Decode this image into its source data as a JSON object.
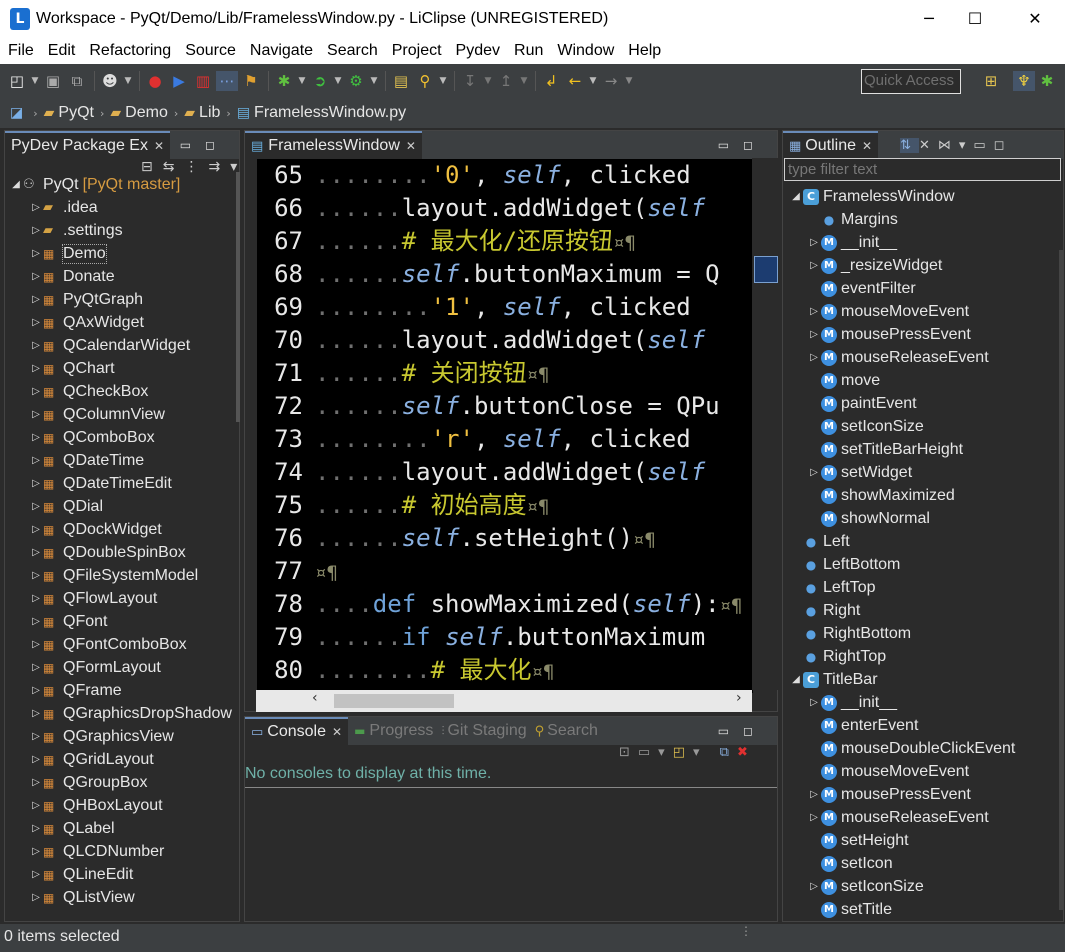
{
  "window": {
    "title": "Workspace - PyQt/Demo/Lib/FramelessWindow.py - LiClipse (UNREGISTERED)",
    "logo": "L",
    "minimize": "─",
    "maximize": "☐",
    "close": "✕"
  },
  "menu": [
    "File",
    "Edit",
    "Refactoring",
    "Source",
    "Navigate",
    "Search",
    "Project",
    "Pydev",
    "Run",
    "Window",
    "Help"
  ],
  "toolbar": {
    "quick_access_placeholder": "Quick Access",
    "icons": [
      "new-icon",
      "save-icon",
      "save-all-icon",
      "settings-icon",
      "stop-icon",
      "run-icon",
      "debug-icon",
      "toggle-icon",
      "open-type-icon",
      "bug-icon",
      "run-green-icon",
      "external-tool-icon",
      "open-file-icon",
      "search-icon",
      "prev-annotation-icon",
      "next-annotation-icon",
      "back-icon",
      "forward-icon",
      "perspective-icon",
      "python-perspective-icon",
      "debug-perspective-icon"
    ]
  },
  "breadcrumb": [
    "PyQt",
    "Demo",
    "Lib",
    "FramelessWindow.py"
  ],
  "explorer": {
    "tab_label": "PyDev Package Ex",
    "project": "PyQt",
    "branch": "[PyQt master]",
    "items": [
      {
        "label": ".idea",
        "kind": "folder"
      },
      {
        "label": ".settings",
        "kind": "folder"
      },
      {
        "label": "Demo",
        "kind": "package"
      },
      {
        "label": "Donate",
        "kind": "package"
      },
      {
        "label": "PyQtGraph",
        "kind": "package"
      },
      {
        "label": "QAxWidget",
        "kind": "package"
      },
      {
        "label": "QCalendarWidget",
        "kind": "package"
      },
      {
        "label": "QChart",
        "kind": "package"
      },
      {
        "label": "QCheckBox",
        "kind": "package"
      },
      {
        "label": "QColumnView",
        "kind": "package"
      },
      {
        "label": "QComboBox",
        "kind": "package"
      },
      {
        "label": "QDateTime",
        "kind": "package"
      },
      {
        "label": "QDateTimeEdit",
        "kind": "package"
      },
      {
        "label": "QDial",
        "kind": "package"
      },
      {
        "label": "QDockWidget",
        "kind": "package"
      },
      {
        "label": "QDoubleSpinBox",
        "kind": "package"
      },
      {
        "label": "QFileSystemModel",
        "kind": "package"
      },
      {
        "label": "QFlowLayout",
        "kind": "package"
      },
      {
        "label": "QFont",
        "kind": "package"
      },
      {
        "label": "QFontComboBox",
        "kind": "package"
      },
      {
        "label": "QFormLayout",
        "kind": "package"
      },
      {
        "label": "QFrame",
        "kind": "package"
      },
      {
        "label": "QGraphicsDropShadow",
        "kind": "package"
      },
      {
        "label": "QGraphicsView",
        "kind": "package"
      },
      {
        "label": "QGridLayout",
        "kind": "package"
      },
      {
        "label": "QGroupBox",
        "kind": "package"
      },
      {
        "label": "QHBoxLayout",
        "kind": "package"
      },
      {
        "label": "QLabel",
        "kind": "package"
      },
      {
        "label": "QLCDNumber",
        "kind": "package"
      },
      {
        "label": "QLineEdit",
        "kind": "package"
      },
      {
        "label": "QListView",
        "kind": "package"
      }
    ]
  },
  "editor": {
    "tab_label": "FramelessWindow",
    "lines": [
      {
        "num": "65",
        "indent": "........",
        "parts": [
          {
            "t": "'0'",
            "c": "str"
          },
          {
            "t": ", ",
            "c": ""
          },
          {
            "t": "self",
            "c": "self"
          },
          {
            "t": ", clicked",
            "c": ""
          }
        ]
      },
      {
        "num": "66",
        "indent": "......",
        "parts": [
          {
            "t": "layout.addWidget(",
            "c": ""
          },
          {
            "t": "self",
            "c": "self"
          }
        ]
      },
      {
        "num": "67",
        "indent": "......",
        "parts": [
          {
            "t": "# 最大化/还原按钮",
            "c": "cm"
          },
          {
            "t": "¤¶",
            "c": "pil"
          }
        ]
      },
      {
        "num": "68",
        "indent": "......",
        "parts": [
          {
            "t": "self",
            "c": "self"
          },
          {
            "t": ".buttonMaximum = Q",
            "c": ""
          }
        ]
      },
      {
        "num": "69",
        "indent": "........",
        "parts": [
          {
            "t": "'1'",
            "c": "str"
          },
          {
            "t": ", ",
            "c": ""
          },
          {
            "t": "self",
            "c": "self"
          },
          {
            "t": ", clicked",
            "c": ""
          }
        ]
      },
      {
        "num": "70",
        "indent": "......",
        "parts": [
          {
            "t": "layout.addWidget(",
            "c": ""
          },
          {
            "t": "self",
            "c": "self"
          }
        ]
      },
      {
        "num": "71",
        "indent": "......",
        "parts": [
          {
            "t": "# 关闭按钮",
            "c": "cm"
          },
          {
            "t": "¤¶",
            "c": "pil"
          }
        ]
      },
      {
        "num": "72",
        "indent": "......",
        "parts": [
          {
            "t": "self",
            "c": "self"
          },
          {
            "t": ".buttonClose = QPu",
            "c": ""
          }
        ]
      },
      {
        "num": "73",
        "indent": "........",
        "parts": [
          {
            "t": "'r'",
            "c": "str"
          },
          {
            "t": ", ",
            "c": ""
          },
          {
            "t": "self",
            "c": "self"
          },
          {
            "t": ", clicked",
            "c": ""
          }
        ]
      },
      {
        "num": "74",
        "indent": "......",
        "parts": [
          {
            "t": "layout.addWidget(",
            "c": ""
          },
          {
            "t": "self",
            "c": "self"
          }
        ]
      },
      {
        "num": "75",
        "indent": "......",
        "parts": [
          {
            "t": "# 初始高度",
            "c": "cm"
          },
          {
            "t": "¤¶",
            "c": "pil"
          }
        ]
      },
      {
        "num": "76",
        "indent": "......",
        "parts": [
          {
            "t": "self",
            "c": "self"
          },
          {
            "t": ".setHeight()",
            "c": ""
          },
          {
            "t": "¤¶",
            "c": "pil"
          }
        ]
      },
      {
        "num": "77",
        "indent": "",
        "parts": [
          {
            "t": "¤¶",
            "c": "pil"
          }
        ]
      },
      {
        "num": "78",
        "indent": "....",
        "parts": [
          {
            "t": "def",
            "c": "kw"
          },
          {
            "t": " showMaximized(",
            "c": ""
          },
          {
            "t": "self",
            "c": "self"
          },
          {
            "t": "):",
            "c": ""
          },
          {
            "t": "¤¶",
            "c": "pil"
          }
        ]
      },
      {
        "num": "79",
        "indent": "......",
        "parts": [
          {
            "t": "if",
            "c": "kw"
          },
          {
            "t": " ",
            "c": ""
          },
          {
            "t": "self",
            "c": "self"
          },
          {
            "t": ".buttonMaximum",
            "c": ""
          }
        ]
      },
      {
        "num": "80",
        "indent": "........",
        "parts": [
          {
            "t": "# 最大化",
            "c": "cm"
          },
          {
            "t": "¤¶",
            "c": "pil"
          }
        ]
      }
    ]
  },
  "console": {
    "tabs": [
      "Console",
      "Progress",
      "Git Staging",
      "Search"
    ],
    "message": "No consoles to display at this time."
  },
  "outline": {
    "tab_label": "Outline",
    "filter_placeholder": "type filter text",
    "items": [
      {
        "label": "FramelessWindow",
        "kind": "class",
        "level": 0,
        "expand": "open"
      },
      {
        "label": "Margins",
        "kind": "attr",
        "level": 1,
        "expand": ""
      },
      {
        "label": "__init__",
        "kind": "method",
        "level": 1,
        "expand": "closed"
      },
      {
        "label": "_resizeWidget",
        "kind": "method",
        "level": 1,
        "expand": "closed"
      },
      {
        "label": "eventFilter",
        "kind": "method",
        "level": 1,
        "expand": ""
      },
      {
        "label": "mouseMoveEvent",
        "kind": "method",
        "level": 1,
        "expand": "closed"
      },
      {
        "label": "mousePressEvent",
        "kind": "method",
        "level": 1,
        "expand": "closed"
      },
      {
        "label": "mouseReleaseEvent",
        "kind": "method",
        "level": 1,
        "expand": "closed"
      },
      {
        "label": "move",
        "kind": "method",
        "level": 1,
        "expand": ""
      },
      {
        "label": "paintEvent",
        "kind": "method",
        "level": 1,
        "expand": ""
      },
      {
        "label": "setIconSize",
        "kind": "method",
        "level": 1,
        "expand": ""
      },
      {
        "label": "setTitleBarHeight",
        "kind": "method",
        "level": 1,
        "expand": ""
      },
      {
        "label": "setWidget",
        "kind": "method",
        "level": 1,
        "expand": "closed"
      },
      {
        "label": "showMaximized",
        "kind": "method",
        "level": 1,
        "expand": ""
      },
      {
        "label": "showNormal",
        "kind": "method",
        "level": 1,
        "expand": ""
      },
      {
        "label": "Left",
        "kind": "attr",
        "level": 0,
        "expand": ""
      },
      {
        "label": "LeftBottom",
        "kind": "attr",
        "level": 0,
        "expand": ""
      },
      {
        "label": "LeftTop",
        "kind": "attr",
        "level": 0,
        "expand": ""
      },
      {
        "label": "Right",
        "kind": "attr",
        "level": 0,
        "expand": ""
      },
      {
        "label": "RightBottom",
        "kind": "attr",
        "level": 0,
        "expand": ""
      },
      {
        "label": "RightTop",
        "kind": "attr",
        "level": 0,
        "expand": ""
      },
      {
        "label": "TitleBar",
        "kind": "class",
        "level": 0,
        "expand": "open"
      },
      {
        "label": "__init__",
        "kind": "method",
        "level": 1,
        "expand": "closed"
      },
      {
        "label": "enterEvent",
        "kind": "method",
        "level": 1,
        "expand": ""
      },
      {
        "label": "mouseDoubleClickEvent",
        "kind": "method",
        "level": 1,
        "expand": ""
      },
      {
        "label": "mouseMoveEvent",
        "kind": "method",
        "level": 1,
        "expand": ""
      },
      {
        "label": "mousePressEvent",
        "kind": "method",
        "level": 1,
        "expand": "closed"
      },
      {
        "label": "mouseReleaseEvent",
        "kind": "method",
        "level": 1,
        "expand": "closed"
      },
      {
        "label": "setHeight",
        "kind": "method",
        "level": 1,
        "expand": ""
      },
      {
        "label": "setIcon",
        "kind": "method",
        "level": 1,
        "expand": ""
      },
      {
        "label": "setIconSize",
        "kind": "method",
        "level": 1,
        "expand": "closed"
      },
      {
        "label": "setTitle",
        "kind": "method",
        "level": 1,
        "expand": ""
      }
    ]
  },
  "status": "0 items selected"
}
